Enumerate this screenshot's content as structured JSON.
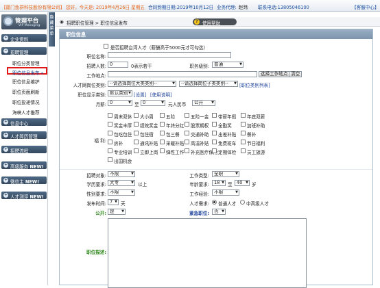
{
  "topbar": {
    "company": "【厦门鱼群科技股份有限公司】",
    "greeting": "您好，今天是: 2019年4月26日 星期五",
    "contract": "合同到期日期:2019年10月12日",
    "consultant_label": "业务代理:",
    "consultant_name": "赵玮",
    "phone": "联系电话:13805046100",
    "service": "【客服中心】"
  },
  "sidebar": {
    "title": "管理平台",
    "subtitle": "VIP Managing",
    "toggle": "隐藏菜单",
    "menus": [
      {
        "label": "企业资料",
        "icon": "plus-icon"
      },
      {
        "label": "招聘管理",
        "icon": "minus-icon"
      },
      {
        "label": "信息中心",
        "icon": "plus-icon"
      },
      {
        "label": "人才简历管理",
        "icon": "plus-icon"
      },
      {
        "label": "招聘流程",
        "icon": "plus-icon"
      },
      {
        "label": "高级服务",
        "badge": "NEW!",
        "icon": "plus-icon"
      },
      {
        "label": "微信主",
        "badge": "NEW!",
        "icon": "plus-icon"
      },
      {
        "label": "人才测评",
        "badge": "NEW!",
        "icon": "plus-icon"
      }
    ],
    "submenu": [
      "职位分类管理",
      "职位信息发布",
      "职位信息维护",
      "职位页面刷新",
      "职位投递情况",
      "海峡人才推荐"
    ]
  },
  "breadcrumb": {
    "trail": "招聘职位管理 > 职位信息发布",
    "help": "使用帮助"
  },
  "form": {
    "heading": "职位信息",
    "taiwan_check": "是否招聘台湾人才（薪酬高于5000元才可勾选）",
    "job_name_label": "职位名称:",
    "count_label": "招聘人数:",
    "count_value": "0",
    "count_hint": "0表示若干",
    "level_label": "职务级别:",
    "level_value": "普通",
    "location_label": "工作地点:",
    "choose_location": "选择工作地点",
    "clear": "清空",
    "category_label": "人才网岗位类别:",
    "category_value": "--请选择岗位大类类别--",
    "subcategory_value": "--请选择岗位子类类别--",
    "category_list": "[职位类别列表]",
    "display_label": "职位显示类别:",
    "display_value": "默认类别",
    "display_set": "[设置]",
    "display_help": "[使用说明]",
    "salary_label": "月薪:",
    "salary_from": "0",
    "salary_to_word": "至",
    "salary_to": "0",
    "salary_unit": "元人民币",
    "salary_public": "公开",
    "benefits_label": "福 利:",
    "benefits": [
      [
        "周末双休",
        "大小周",
        "五险",
        "五险一金",
        "带薪年假",
        "年底双薪"
      ],
      [
        "奖金丰厚",
        "绩效奖金",
        "年终分红",
        "股票期权",
        "全勤奖",
        "加班补助"
      ],
      [
        "包吃包住",
        "包住宿",
        "包三餐",
        "交通补助",
        "出差补贴",
        "餐补"
      ],
      [
        "房补",
        "通讯补贴",
        "采暖补贴",
        "高温补贴",
        "免费班车",
        "节日福利"
      ],
      [
        "专业培训",
        "立即上岗",
        "弹性工作",
        "补充医疗保险",
        "定期体检",
        "员工旅游"
      ],
      [
        "出国机会"
      ]
    ],
    "target_label": "招聘对象:",
    "target_value": "不限",
    "jobtype_label": "工作类型:",
    "jobtype_value": "全职",
    "edu_label": "学历要求:",
    "edu_value": "大专",
    "edu_suffix": "以上",
    "age_label": "年龄要求:",
    "age_from": "18",
    "age_to_word": "至",
    "age_to": "40",
    "age_unit": "岁",
    "gender_label": "性别要求:",
    "gender_value": "不限",
    "exp_label": "工作经验:",
    "exp_value": "不限",
    "days_label": "发布时间:",
    "days_value": "7",
    "days_unit": "天",
    "talent_label": "人才需求:",
    "talent_normal": "普通人才",
    "talent_senior": "中高级人才",
    "public_label": "公开:",
    "public_value": "是",
    "urgent_label": "紧急职位:",
    "urgent_value": "否",
    "desc_label": "职位描述:"
  },
  "colors": {
    "brand_orange": "#e8671c",
    "accent_blue": "#1c4fa0",
    "highlight_red": "#e01818"
  }
}
